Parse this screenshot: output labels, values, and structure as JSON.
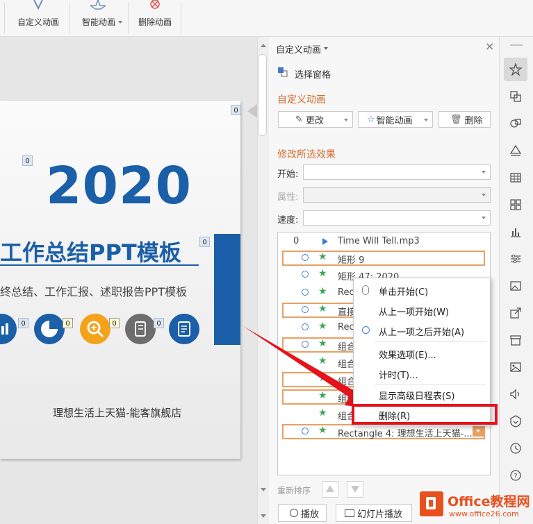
{
  "toolbar": {
    "custom_animation": "自定义动画",
    "smart_animation": "智能动画",
    "delete_animation": "删除动画"
  },
  "slide": {
    "year": "2020",
    "title": "工作总结PPT模板",
    "subtitle": "终总结、工作汇报、述职报告PPT模板",
    "shop": "理想生活上天猫-能客旗舰店",
    "tags": [
      "0",
      "0",
      "0",
      "0",
      "0",
      "0",
      "0"
    ]
  },
  "pane": {
    "title": "自定义动画",
    "select_pane": "选择窗格",
    "section1": "自定义动画",
    "change_btn": "更改",
    "smart_btn": "智能动画",
    "delete_btn": "删除",
    "section2": "修改所选效果",
    "start_label": "开始:",
    "property_label": "属性:",
    "speed_label": "速度:",
    "reorder_label": "重新排序",
    "play_btn": "播放",
    "slideshow_btn": "幻灯片播放"
  },
  "list": [
    {
      "index": "0",
      "text": "Time Will Tell.mp3"
    },
    {
      "index": "",
      "text": "矩形 9"
    },
    {
      "index": "",
      "text": "矩形 47: 2020"
    },
    {
      "index": "",
      "text": "Rec"
    },
    {
      "index": "",
      "text": "直接"
    },
    {
      "index": "",
      "text": "Rec"
    },
    {
      "index": "",
      "text": "组合"
    },
    {
      "index": "",
      "text": "组合"
    },
    {
      "index": "",
      "text": "组合"
    },
    {
      "index": "",
      "text": "组合"
    },
    {
      "index": "",
      "text": "组合"
    },
    {
      "index": "",
      "text": "Rectangle 4: 理想生活上天猫-..."
    }
  ],
  "context_menu": {
    "items": [
      "单击开始(C)",
      "从上一项开始(W)",
      "从上一项之后开始(A)",
      "效果选项(E)...",
      "计时(T)...",
      "显示高级日程表(S)",
      "删除(R)"
    ]
  },
  "watermark": {
    "brand": "Office教程网",
    "url": "www.office26.com"
  },
  "colors": {
    "accent": "#1a5fa8",
    "orange": "#d4682a",
    "highlight": "#e5131b"
  }
}
